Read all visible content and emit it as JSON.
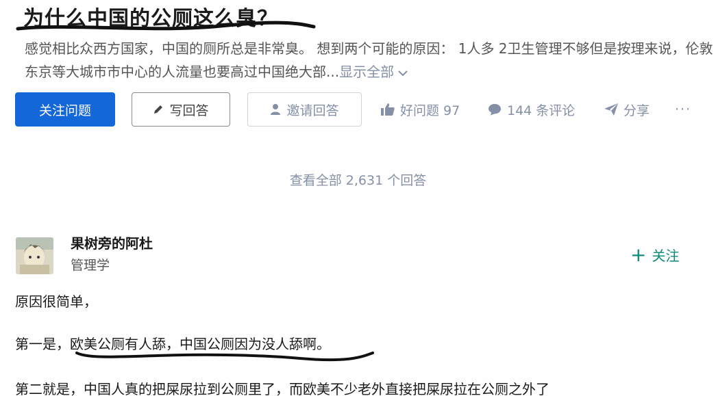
{
  "question": {
    "title": "为什么中国的公厕这么臭？",
    "description": "感觉相比众西方国家，中国的厕所总是非常臭。 想到两个可能的原因： 1人多 2卫生管理不够但是按理来说，伦敦东京等大城市市中心的人流量也要高过中国绝大部...",
    "show_all": "显示全部"
  },
  "actions": {
    "follow_question": "关注问题",
    "write_answer": "写回答",
    "invite_answer": "邀请回答",
    "good_question": "好问题 97",
    "comments": "144 条评论",
    "share": "分享",
    "more": "···"
  },
  "answers": {
    "view_all": "查看全部 2,631 个回答"
  },
  "answer": {
    "author_name": "果树旁的阿杜",
    "author_bio": "管理学",
    "follow_label": "关注",
    "paragraphs": [
      "原因很简单，",
      "第一是，欧美公厕有人舔，中国公厕因为没人舔啊。",
      "第二就是，中国人真的把屎尿拉到公厕里了，而欧美不少老外直接把屎尿拉在公厕之外了"
    ]
  },
  "colors": {
    "primary_blue": "#1467d8",
    "meta_gray": "#8590a6",
    "follow_green": "#0e8a7a"
  }
}
